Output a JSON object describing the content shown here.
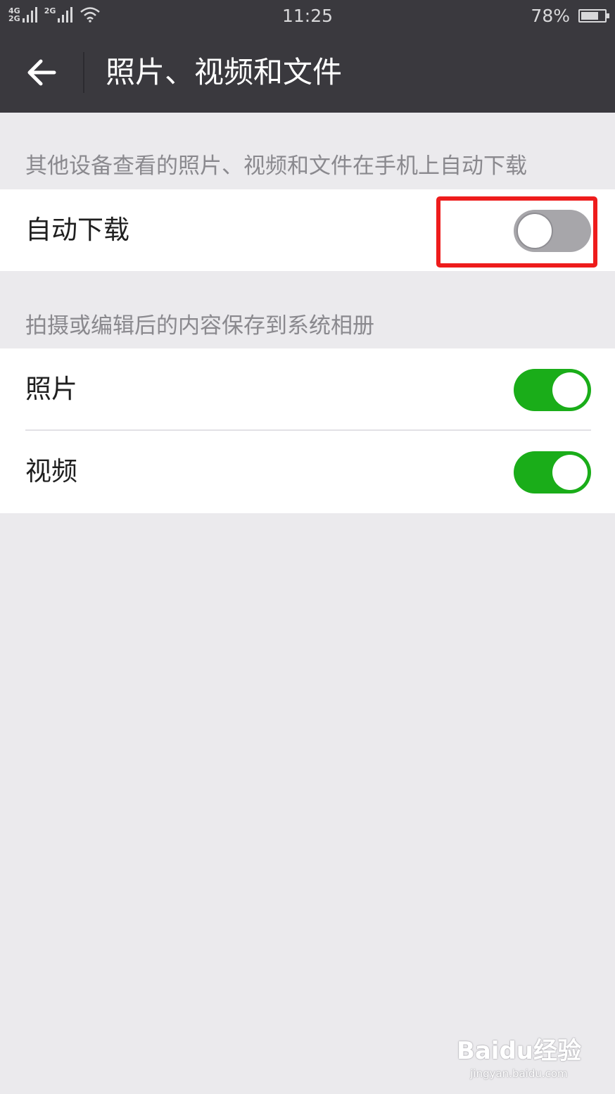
{
  "status_bar": {
    "network_1": "4G",
    "network_1b": "2G",
    "network_2": "2G",
    "time": "11:25",
    "battery_text": "78%",
    "battery_level": 0.78,
    "icons": [
      "signal-icon",
      "wifi-icon",
      "battery-icon"
    ]
  },
  "header": {
    "back_icon": "back-arrow-icon",
    "title": "照片、视频和文件"
  },
  "sections": [
    {
      "header": "其他设备查看的照片、视频和文件在手机上自动下载",
      "items": [
        {
          "label": "自动下载",
          "on": false
        }
      ]
    },
    {
      "header": "拍摄或编辑后的内容保存到系统相册",
      "items": [
        {
          "label": "照片",
          "on": true
        },
        {
          "label": "视频",
          "on": true
        }
      ]
    }
  ],
  "colors": {
    "toggle_on": "#1aad19",
    "toggle_off": "#a7a6aa",
    "highlight": "#ee1c1c",
    "bar_bg": "#3a393e",
    "page_bg": "#ebeaed"
  },
  "watermark": {
    "main": "Baidu经验",
    "sub": "jingyan.baidu.com"
  }
}
